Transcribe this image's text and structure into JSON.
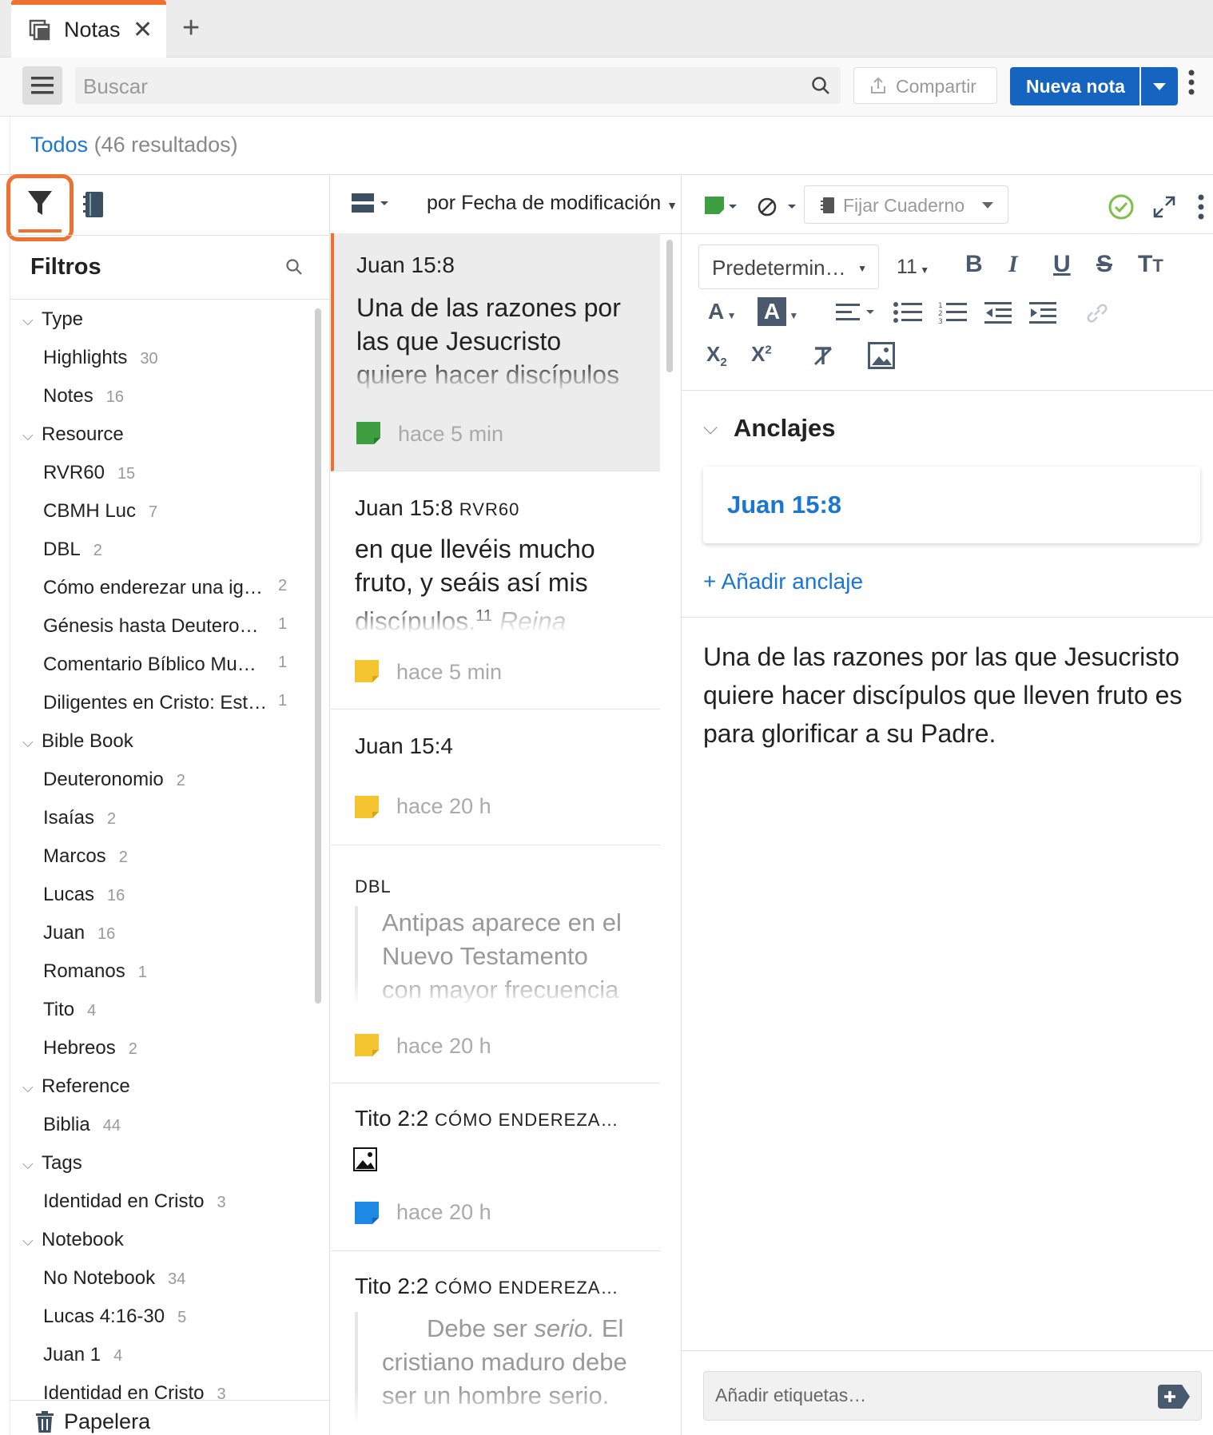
{
  "tab": {
    "label": "Notas"
  },
  "toolbar": {
    "search_placeholder": "Buscar",
    "share_label": "Compartir",
    "new_note_label": "Nueva nota"
  },
  "results": {
    "filter_label": "Todos",
    "count_label": "(46 resultados)"
  },
  "filters": {
    "title": "Filtros",
    "groups": [
      {
        "label": "Type",
        "items": [
          {
            "label": "Highlights",
            "count": "30"
          },
          {
            "label": "Notes",
            "count": "16"
          }
        ]
      },
      {
        "label": "Resource",
        "items": [
          {
            "label": "RVR60",
            "count": "15"
          },
          {
            "label": "CBMH Luc",
            "count": "7"
          },
          {
            "label": "DBL",
            "count": "2"
          },
          {
            "label": "Cómo enderezar una ig…",
            "count": "2"
          },
          {
            "label": "Génesis hasta Deutero…",
            "count": "1"
          },
          {
            "label": "Comentario Bíblico Mu…",
            "count": "1"
          },
          {
            "label": "Diligentes en Cristo: Est…",
            "count": "1"
          }
        ]
      },
      {
        "label": "Bible Book",
        "items": [
          {
            "label": "Deuteronomio",
            "count": "2"
          },
          {
            "label": "Isaías",
            "count": "2"
          },
          {
            "label": "Marcos",
            "count": "2"
          },
          {
            "label": "Lucas",
            "count": "16"
          },
          {
            "label": "Juan",
            "count": "16"
          },
          {
            "label": "Romanos",
            "count": "1"
          },
          {
            "label": "Tito",
            "count": "4"
          },
          {
            "label": "Hebreos",
            "count": "2"
          }
        ]
      },
      {
        "label": "Reference",
        "items": [
          {
            "label": "Biblia",
            "count": "44"
          }
        ]
      },
      {
        "label": "Tags",
        "items": [
          {
            "label": "Identidad en Cristo",
            "count": "3"
          }
        ]
      },
      {
        "label": "Notebook",
        "items": [
          {
            "label": "No Notebook",
            "count": "34"
          },
          {
            "label": "Lucas 4:16-30",
            "count": "5"
          },
          {
            "label": "Juan 1",
            "count": "4"
          },
          {
            "label": "Identidad en Cristo",
            "count": "3"
          }
        ]
      }
    ],
    "trash_label": "Papelera"
  },
  "notes_list": {
    "sort_label": "por Fecha de modificación",
    "cards": [
      {
        "ref": "Juan 15:8",
        "body": "Una de las razones por las que Jesucristo quiere hacer discípulos que",
        "time": "hace 5 min",
        "flag_color": "#3f9e3f"
      },
      {
        "ref": "Juan 15:8",
        "ref_small": "RVR60",
        "body": "en que llevéis mucho fruto, y seáis así mis discípulos.",
        "sup": "11",
        "body_em": "Reina",
        "time": "hace 5 min",
        "flag_color": "#f5c431"
      },
      {
        "ref": "Juan 15:4",
        "time": "hace 20 h",
        "flag_color": "#f5c431"
      },
      {
        "ref_small": "DBL",
        "quote": "Antipas aparece en el Nuevo Testamento con mayor frecuencia que",
        "time": "hace 20 h",
        "flag_color": "#f5c431"
      },
      {
        "ref": "Tito 2:2",
        "ref_small": "CÓMO ENDEREZA…",
        "time": "hace 20 h",
        "flag_color": "#1e88e5"
      },
      {
        "ref": "Tito 2:2",
        "ref_small": "CÓMO ENDEREZA…",
        "quote_a": "Debe ser",
        "quote_em": "serio.",
        "quote_b": "El cristiano maduro debe ser un hombre serio."
      }
    ]
  },
  "editor": {
    "notebook_placeholder": "Fijar Cuaderno",
    "font_label": "Predetermin…",
    "font_size": "11",
    "anchors_title": "Anclajes",
    "anchor_ref": "Juan 15:8",
    "add_anchor": "+ Añadir anclaje",
    "note_text": "Una de las razones por las que Jesucristo quiere hacer discípulos que lleven fruto es para glorificar a su Padre.",
    "tags_placeholder": "Añadir etiquetas…"
  },
  "colors": {
    "accent": "#1565c0",
    "highlight": "#f07030",
    "link": "#1976d2"
  }
}
